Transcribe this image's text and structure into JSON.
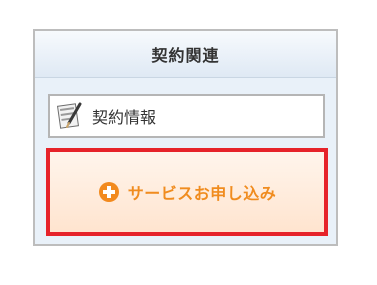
{
  "panel": {
    "title": "契約関連"
  },
  "contract_info": {
    "icon": "document-pen-icon",
    "label": "契約情報"
  },
  "service_apply": {
    "icon": "plus-circle-icon",
    "label": "サービスお申し込み",
    "highlight_color": "#e6232a",
    "text_color": "#f08c1f"
  }
}
